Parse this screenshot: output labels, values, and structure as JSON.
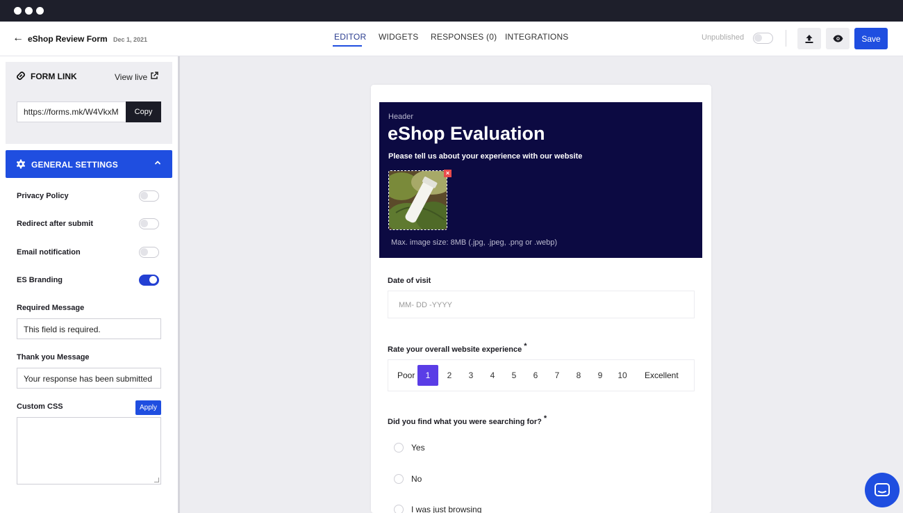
{
  "window": {
    "controls": [
      "close-dot",
      "minimize-dot",
      "maximize-dot"
    ]
  },
  "topbar": {
    "form_name": "eShop Review Form",
    "date": "Dec 1, 2021",
    "tabs": [
      {
        "label": "EDITOR",
        "active": true
      },
      {
        "label": "WIDGETS",
        "active": false
      },
      {
        "label": "RESPONSES (0)",
        "active": false
      },
      {
        "label": "INTEGRATIONS",
        "active": false
      }
    ],
    "publish_status": "Unpublished",
    "publish_toggle": false,
    "icons": [
      "upload-icon",
      "eye-icon"
    ],
    "save_label": "Save",
    "accent": "#1f4ee0"
  },
  "sidebar": {
    "form_link": {
      "title": "FORM LINK",
      "view_live": "View live",
      "url": "https://forms.mk/W4VkxM",
      "copy_label": "Copy"
    },
    "general_settings": {
      "title": "GENERAL SETTINGS",
      "expanded": true,
      "toggles": [
        {
          "label": "Privacy Policy",
          "on": false
        },
        {
          "label": "Redirect after submit",
          "on": false
        },
        {
          "label": "Email notification",
          "on": false
        },
        {
          "label": "ES Branding",
          "on": true
        }
      ],
      "required_message": {
        "label": "Required Message",
        "value": "This field is required."
      },
      "thank_you_message": {
        "label": "Thank you Message",
        "value": "Your response has been submitted"
      },
      "custom_css": {
        "label": "Custom CSS",
        "apply_label": "Apply",
        "value": ""
      }
    }
  },
  "form": {
    "header": {
      "eyebrow": "Header",
      "title": "eShop Evaluation",
      "subtitle": "Please tell us about your experience with our website",
      "image_note": "Max. image size: 8MB (.jpg, .jpeg, .png or .webp)",
      "background": "#0c0a42"
    },
    "date_question": {
      "label": "Date of visit",
      "placeholder": "MM- DD -YYYY"
    },
    "rating_question": {
      "label": "Rate your overall website experience",
      "required_mark": "*",
      "low_label": "Poor",
      "high_label": "Excellent",
      "options": [
        "1",
        "2",
        "3",
        "4",
        "5",
        "6",
        "7",
        "8",
        "9",
        "10"
      ],
      "selected": "1",
      "selected_color": "#5a3de6"
    },
    "search_question": {
      "label": "Did you find what you were searching for?",
      "required_mark": "*",
      "options": [
        "Yes",
        "No",
        "I was just browsing"
      ]
    }
  },
  "chat_widget": {
    "icon": "chat-icon"
  }
}
